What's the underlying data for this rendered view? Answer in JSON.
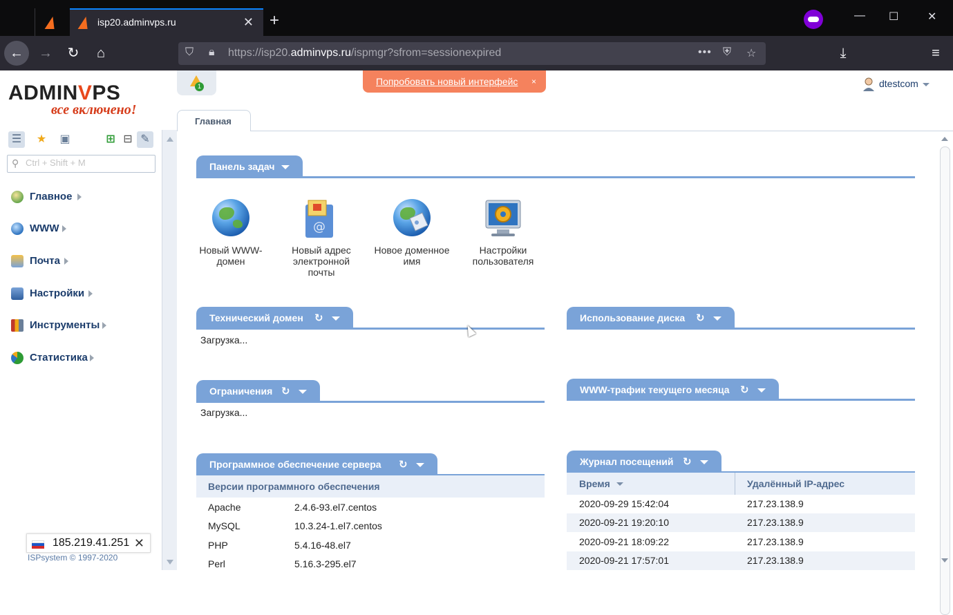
{
  "browser": {
    "tab_title": "isp20.adminvps.ru",
    "url_prefix": "https://isp20.",
    "url_domain": "adminvps.ru",
    "url_path": "/ispmgr?sfrom=sessionexpired",
    "icons": [
      "back-icon",
      "forward-icon",
      "reload-icon",
      "home-icon",
      "shield-icon",
      "lock-icon",
      "more-icon",
      "pocket-icon",
      "star-icon",
      "download-icon",
      "menu-icon",
      "private-mask-icon"
    ]
  },
  "logo": {
    "line1_a": "ADMIN",
    "line1_b": "V",
    "line1_c": "PS",
    "line2": "все включено!"
  },
  "sidebar": {
    "search_placeholder": "Ctrl + Shift + M",
    "items": [
      {
        "label": "Главное",
        "icon": "home-icon"
      },
      {
        "label": "WWW",
        "icon": "www-icon"
      },
      {
        "label": "Почта",
        "icon": "mail-icon"
      },
      {
        "label": "Настройки",
        "icon": "settings-icon"
      },
      {
        "label": "Инструменты",
        "icon": "tools-icon"
      },
      {
        "label": "Статистика",
        "icon": "stats-icon"
      }
    ],
    "ip_address": "185.219.41.251",
    "copyright": "ISPsystem © 1997-2020"
  },
  "header": {
    "notifications_count": "1",
    "try_new_ui": "Попробовать новый интерфейс",
    "try_close": "×",
    "username": "dtestcom"
  },
  "main": {
    "tab_label": "Главная",
    "tasks_panel": "Панель задач",
    "tasks": [
      {
        "label": "Новый WWW-домен",
        "icon": "globe-icon"
      },
      {
        "label": "Новый адрес электронной почты",
        "icon": "mailbox-icon"
      },
      {
        "label": "Новое доменное имя",
        "icon": "globe-tag-icon"
      },
      {
        "label": "Настройки пользователя",
        "icon": "monitor-gear-icon"
      }
    ],
    "tech_domain": {
      "title": "Технический домен",
      "status": "Загрузка..."
    },
    "disk_usage": {
      "title": "Использование диска"
    },
    "limits": {
      "title": "Ограничения",
      "status": "Загрузка..."
    },
    "www_traffic": {
      "title": "WWW-трафик текущего месяца"
    },
    "software": {
      "title": "Программное обеспечение сервера",
      "subheader": "Версии программного обеспечения",
      "rows": [
        {
          "name": "Apache",
          "version": "2.4.6-93.el7.centos"
        },
        {
          "name": "MySQL",
          "version": "10.3.24-1.el7.centos"
        },
        {
          "name": "PHP",
          "version": "5.4.16-48.el7"
        },
        {
          "name": "Perl",
          "version": "5.16.3-295.el7"
        }
      ]
    },
    "visit_log": {
      "title": "Журнал посещений",
      "col_time": "Время",
      "col_ip": "Удалённый IP-адрес",
      "rows": [
        {
          "time": "2020-09-29 15:42:04",
          "ip": "217.23.138.9"
        },
        {
          "time": "2020-09-21 19:20:10",
          "ip": "217.23.138.9"
        },
        {
          "time": "2020-09-21 18:09:22",
          "ip": "217.23.138.9"
        },
        {
          "time": "2020-09-21 17:57:01",
          "ip": "217.23.138.9"
        }
      ]
    }
  },
  "colors": {
    "accent": "#7aa3d8",
    "brand_orange": "#e8481c",
    "banner": "#f5825d",
    "nav_text": "#1b3c6b"
  }
}
